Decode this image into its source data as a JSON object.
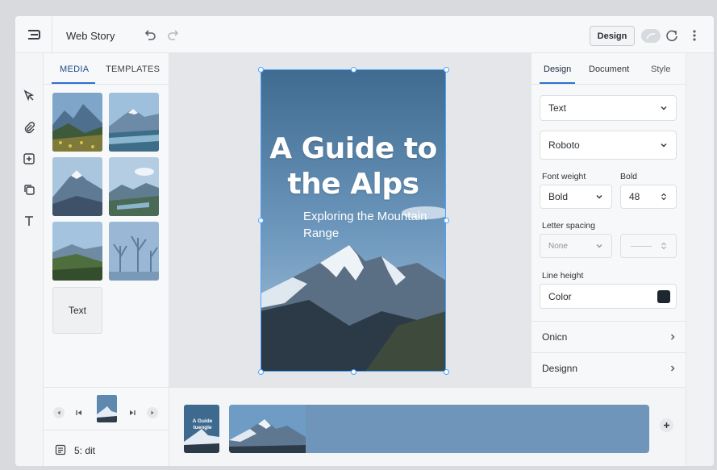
{
  "app": {
    "title": "Web Story",
    "design_button": "Design"
  },
  "media_panel": {
    "tabs": [
      "MEDIA",
      "TEMPLATES"
    ],
    "text_tile": "Text"
  },
  "story": {
    "title": "A Guide to the Alps",
    "subtitle": "Exploring the Mountain Range"
  },
  "properties": {
    "tabs": [
      "Design",
      "Document",
      "Style"
    ],
    "element_type": "Text",
    "font_family": "Roboto",
    "font_weight_label": "Font weight",
    "font_weight_value": "Bold",
    "bold_label": "Bold",
    "bold_value": "48",
    "letter_spacing_label": "Letter spacing",
    "letter_spacing_value": "None",
    "line_height_label": "Line height",
    "color_label": "Color",
    "color_value": "#1e2630",
    "sections": [
      "Onicn",
      "Designn"
    ]
  },
  "pages": {
    "label": "5: dit"
  },
  "timeline": {
    "card_text": "A Guide tuengle"
  },
  "colors": {
    "accent": "#2f6fd0",
    "selection": "#4aa3ff",
    "timeline_track": "#6f95bb"
  }
}
